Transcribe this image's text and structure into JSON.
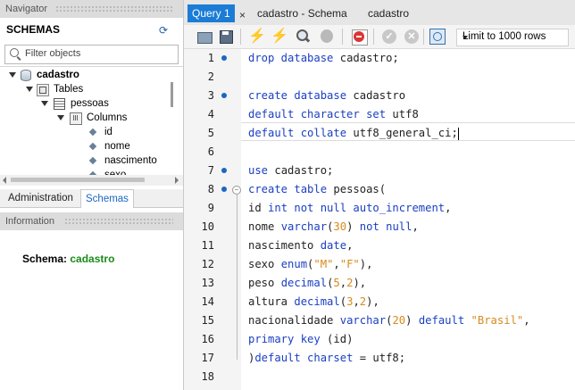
{
  "navigator": {
    "title": "Navigator",
    "schemas_heading": "SCHEMAS",
    "filter_placeholder": "Filter objects",
    "tree": {
      "db": "cadastro",
      "tables": "Tables",
      "table": "pessoas",
      "columns_label": "Columns",
      "columns": [
        "id",
        "nome",
        "nascimento",
        "sexo"
      ]
    },
    "tabs": [
      "Administration",
      "Schemas"
    ],
    "active_tab": "Schemas"
  },
  "information": {
    "title": "Information",
    "schema_label": "Schema:",
    "schema_value": "cadastro",
    "schema_color": "#1b8a1b"
  },
  "editor_tabs": {
    "query_tab": "Query 1",
    "close": "×",
    "schema_tab": "cadastro - Schema",
    "table_tab": "cadastro"
  },
  "toolbar": {
    "icons": [
      "folder-icon",
      "save-icon",
      "execute-icon",
      "execute-current-icon",
      "explain-icon",
      "stop-icon",
      "toggle-error-icon",
      "commit-icon",
      "rollback-icon",
      "autocommit-icon"
    ],
    "limit_label": "Limit to 1000 rows"
  },
  "code": {
    "line_numbers": [
      "1",
      "2",
      "3",
      "4",
      "5",
      "6",
      "7",
      "8",
      "9",
      "10",
      "11",
      "12",
      "13",
      "14",
      "15",
      "16",
      "17",
      "18"
    ],
    "lines": [
      [
        [
          "k",
          "drop database"
        ],
        [
          "t",
          " cadastro;"
        ]
      ],
      [],
      [
        [
          "k",
          "create database"
        ],
        [
          "t",
          " cadastro"
        ]
      ],
      [
        [
          "k",
          "default character set"
        ],
        [
          "t",
          " utf8"
        ]
      ],
      [
        [
          "k",
          "default collate"
        ],
        [
          "t",
          " utf8_general_ci;"
        ]
      ],
      [],
      [
        [
          "k",
          "use"
        ],
        [
          "t",
          " cadastro;"
        ]
      ],
      [
        [
          "k",
          "create table"
        ],
        [
          "t",
          " pessoas("
        ]
      ],
      [
        [
          "t",
          "id "
        ],
        [
          "k",
          "int not null auto_increment"
        ],
        [
          "t",
          ","
        ]
      ],
      [
        [
          "t",
          "nome "
        ],
        [
          "k",
          "varchar"
        ],
        [
          "t",
          "("
        ],
        [
          "n",
          "30"
        ],
        [
          "t",
          ") "
        ],
        [
          "k",
          "not null"
        ],
        [
          "t",
          ","
        ]
      ],
      [
        [
          "t",
          "nascimento "
        ],
        [
          "k",
          "date"
        ],
        [
          "t",
          ","
        ]
      ],
      [
        [
          "t",
          "sexo "
        ],
        [
          "k",
          "enum"
        ],
        [
          "t",
          "("
        ],
        [
          "s",
          "\"M\""
        ],
        [
          "t",
          ","
        ],
        [
          "s",
          "\"F\""
        ],
        [
          "t",
          "),"
        ]
      ],
      [
        [
          "t",
          "peso "
        ],
        [
          "k",
          "decimal"
        ],
        [
          "t",
          "("
        ],
        [
          "n",
          "5"
        ],
        [
          "t",
          ","
        ],
        [
          "n",
          "2"
        ],
        [
          "t",
          "),"
        ]
      ],
      [
        [
          "t",
          "altura "
        ],
        [
          "k",
          "decimal"
        ],
        [
          "t",
          "("
        ],
        [
          "n",
          "3"
        ],
        [
          "t",
          ","
        ],
        [
          "n",
          "2"
        ],
        [
          "t",
          "),"
        ]
      ],
      [
        [
          "t",
          "nacionalidade "
        ],
        [
          "k",
          "varchar"
        ],
        [
          "t",
          "("
        ],
        [
          "n",
          "20"
        ],
        [
          "t",
          ") "
        ],
        [
          "k",
          "default"
        ],
        [
          "t",
          " "
        ],
        [
          "s",
          "\"Brasil\""
        ],
        [
          "t",
          ","
        ]
      ],
      [
        [
          "k",
          "primary key"
        ],
        [
          "t",
          " (id)"
        ]
      ],
      [
        [
          "t",
          ")"
        ],
        [
          "k",
          "default charset"
        ],
        [
          "t",
          " = utf8;"
        ]
      ],
      []
    ],
    "statement_dot_lines": [
      1,
      3,
      7,
      8
    ],
    "keyword_color": "#1a3fc2",
    "literal_color": "#d8891e"
  }
}
